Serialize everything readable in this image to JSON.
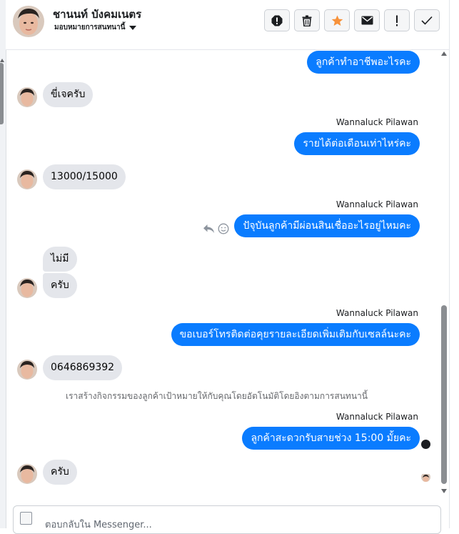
{
  "header": {
    "contact_name": "ชานนท์ บังคมเนตร",
    "assign_label": "มอบหมายการสนทนานี้"
  },
  "toolbar": [
    {
      "name": "report-spam-button",
      "icon": "octagon-alert-icon"
    },
    {
      "name": "delete-button",
      "icon": "trash-icon"
    },
    {
      "name": "star-button",
      "icon": "star-icon",
      "color": "#f7923a"
    },
    {
      "name": "mark-unread-button",
      "icon": "envelope-icon"
    },
    {
      "name": "follow-up-button",
      "icon": "exclamation-icon"
    },
    {
      "name": "mark-done-button",
      "icon": "checkmark-icon"
    }
  ],
  "messages": [
    {
      "direction": "out",
      "text": "ลูกค้าทำอาชีพอะไรคะ"
    },
    {
      "direction": "in",
      "text": "ขี่เจครับ"
    },
    {
      "direction": "out",
      "sender": "Wannaluck Pilawan",
      "text": "รายได้ต่อเดือนเท่าไหร่คะ"
    },
    {
      "direction": "in",
      "text": "13000/15000"
    },
    {
      "direction": "out",
      "sender": "Wannaluck Pilawan",
      "text": "ปัจุบันลูกค้ามีผ่อนสินเชื่ออะไรอยู่ไหมคะ"
    },
    {
      "direction": "in",
      "text": "ไม่มี"
    },
    {
      "direction": "in",
      "text": "ครับ"
    },
    {
      "direction": "out",
      "sender": "Wannaluck Pilawan",
      "text": "ขอเบอร์โทรติดต่อคุยรายละเอียดเพิ่มเติมกับเซลล์นะคะ"
    },
    {
      "direction": "in",
      "text": "0646869392"
    },
    {
      "direction": "system",
      "text": "เราสร้างกิจกรรมของลูกค้าเป้าหมายให้กับคุณโดยอัตโนมัติโดยอิงตามการสนทนานี้"
    },
    {
      "direction": "out",
      "sender": "Wannaluck Pilawan",
      "text": "ลูกค้าสะดวกรับสายช่วง 15:00 มั้ยคะ"
    },
    {
      "direction": "in",
      "text": "ครับ"
    }
  ],
  "composer": {
    "placeholder": "ตอบกลับใน Messenger..."
  },
  "colors": {
    "outgoing_bubble": "#0a7cff",
    "incoming_bubble": "#e4e6eb",
    "star_accent": "#f7923a"
  }
}
